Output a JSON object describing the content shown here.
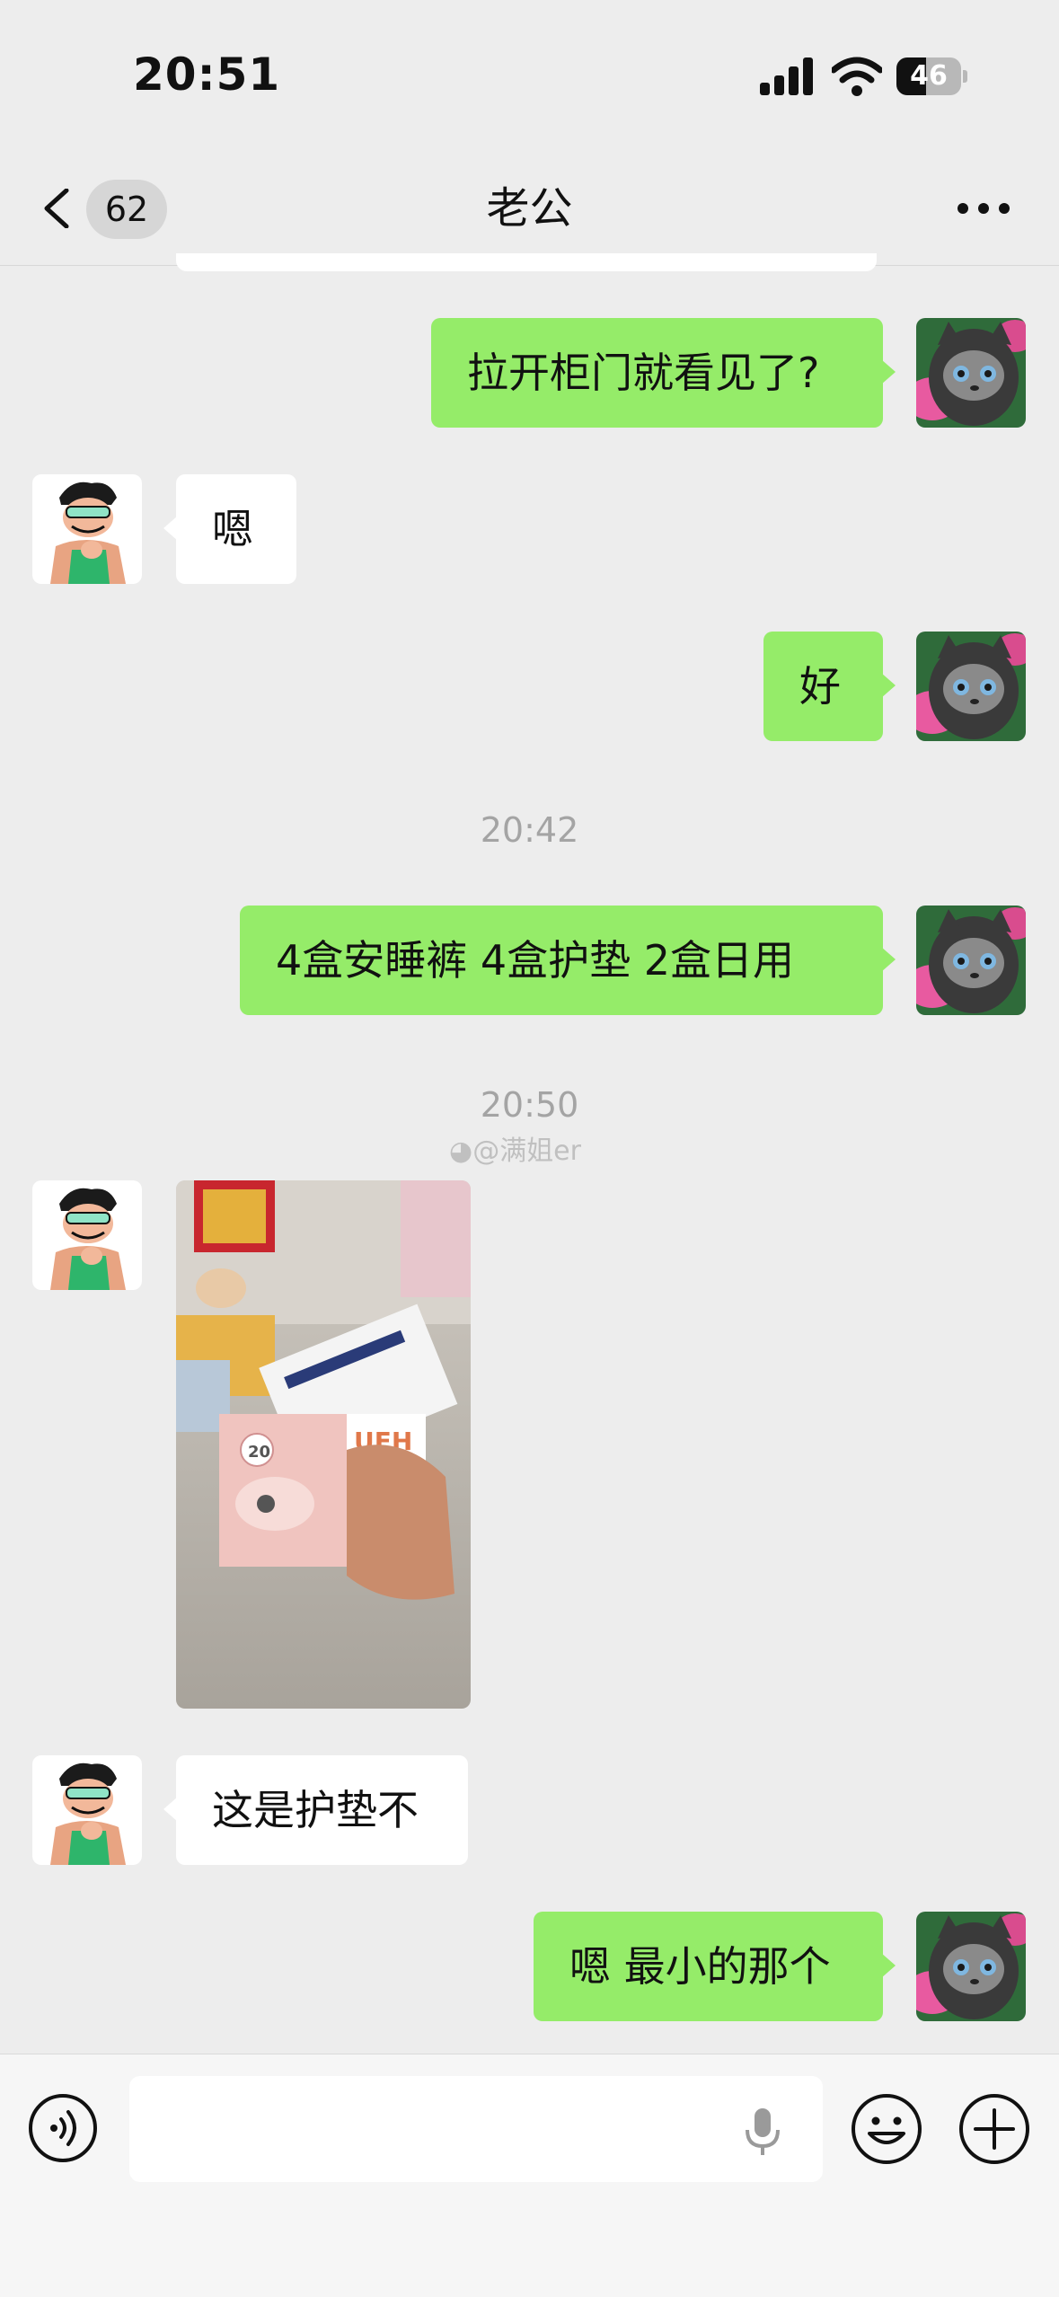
{
  "status_bar": {
    "time": "20:51",
    "battery": "46",
    "battery_level": 0.46
  },
  "nav": {
    "unread_count": "62",
    "title": "老公"
  },
  "messages": [
    {
      "sender": "me",
      "type": "text",
      "text": "拉开柜门就看见了?"
    },
    {
      "sender": "other",
      "type": "text",
      "text": "嗯"
    },
    {
      "sender": "me",
      "type": "text",
      "text": "好"
    },
    {
      "type": "timestamp",
      "text": "20:42"
    },
    {
      "sender": "me",
      "type": "text",
      "text": "4盒安睡裤 4盒护垫 2盒日用"
    },
    {
      "type": "timestamp",
      "text": "20:50"
    },
    {
      "sender": "other",
      "type": "image",
      "image_text": "UEH",
      "image_badge": "20"
    },
    {
      "sender": "other",
      "type": "text",
      "text": "这是护垫不"
    },
    {
      "sender": "me",
      "type": "text",
      "text": "嗯 最小的那个"
    }
  ],
  "watermark": "@满姐er",
  "icons": {
    "back": "chevron-left-icon",
    "more": "more-dots-icon",
    "voice": "voice-icon",
    "mic": "microphone-icon",
    "emoji": "emoji-icon",
    "plus": "plus-icon"
  },
  "colors": {
    "background": "#ededed",
    "outgoing_bubble": "#95ec69",
    "incoming_bubble": "#ffffff",
    "timestamp": "#a4a4a4"
  }
}
